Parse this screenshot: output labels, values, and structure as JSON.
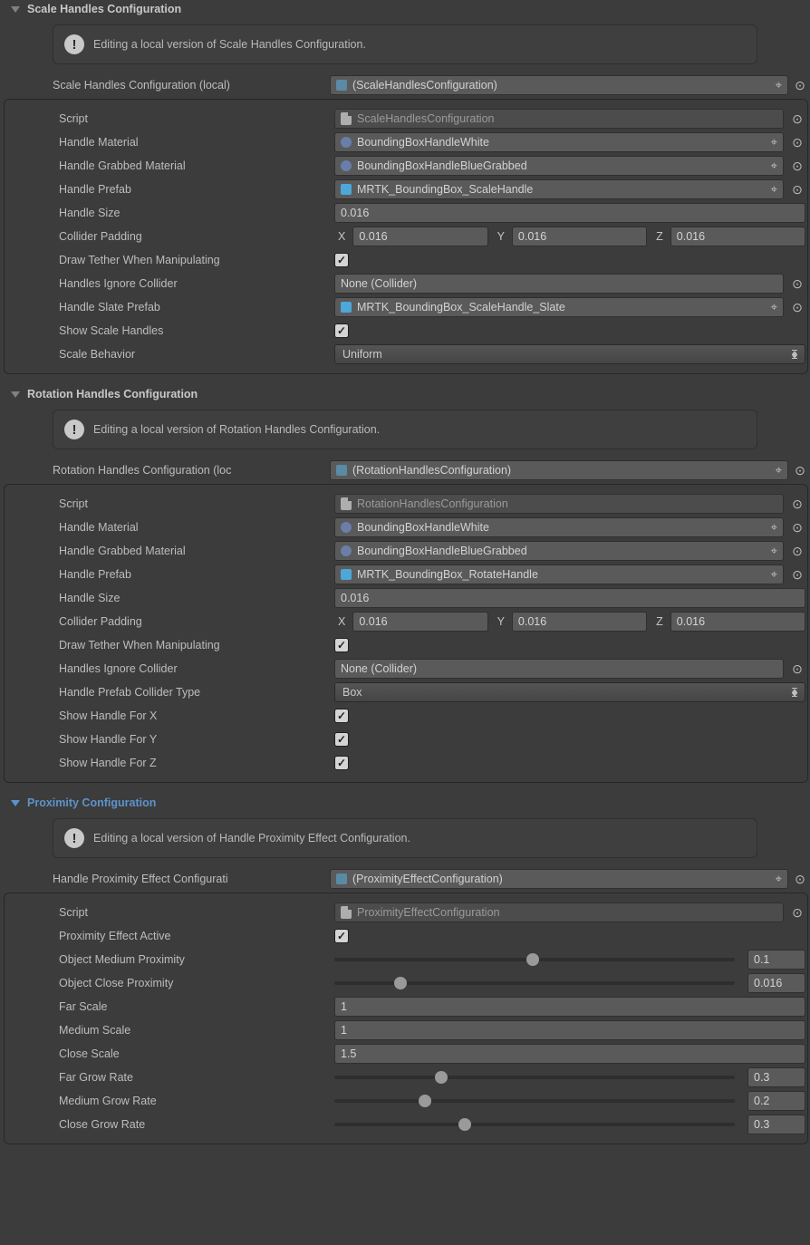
{
  "scale": {
    "title": "Scale Handles Configuration",
    "info": "Editing a local version of Scale Handles Configuration.",
    "cfg_label": "Scale Handles Configuration (local)",
    "cfg_value": "(ScaleHandlesConfiguration)",
    "script_label": "Script",
    "script_value": "ScaleHandlesConfiguration",
    "material_label": "Handle Material",
    "material_value": "BoundingBoxHandleWhite",
    "grabbed_label": "Handle Grabbed Material",
    "grabbed_value": "BoundingBoxHandleBlueGrabbed",
    "prefab_label": "Handle Prefab",
    "prefab_value": "MRTK_BoundingBox_ScaleHandle",
    "size_label": "Handle Size",
    "size_value": "0.016",
    "pad_label": "Collider Padding",
    "pad_x": "0.016",
    "pad_y": "0.016",
    "pad_z": "0.016",
    "tether_label": "Draw Tether When Manipulating",
    "ignore_label": "Handles Ignore Collider",
    "ignore_value": "None (Collider)",
    "slate_label": "Handle Slate Prefab",
    "slate_value": "MRTK_BoundingBox_ScaleHandle_Slate",
    "show_label": "Show Scale Handles",
    "behavior_label": "Scale Behavior",
    "behavior_value": "Uniform"
  },
  "rot": {
    "title": "Rotation Handles Configuration",
    "info": "Editing a local version of Rotation Handles Configuration.",
    "cfg_label": "Rotation Handles Configuration (loc",
    "cfg_value": "(RotationHandlesConfiguration)",
    "script_label": "Script",
    "script_value": "RotationHandlesConfiguration",
    "material_label": "Handle Material",
    "material_value": "BoundingBoxHandleWhite",
    "grabbed_label": "Handle Grabbed Material",
    "grabbed_value": "BoundingBoxHandleBlueGrabbed",
    "prefab_label": "Handle Prefab",
    "prefab_value": "MRTK_BoundingBox_RotateHandle",
    "size_label": "Handle Size",
    "size_value": "0.016",
    "pad_label": "Collider Padding",
    "pad_x": "0.016",
    "pad_y": "0.016",
    "pad_z": "0.016",
    "tether_label": "Draw Tether When Manipulating",
    "ignore_label": "Handles Ignore Collider",
    "ignore_value": "None (Collider)",
    "collider_type_label": "Handle Prefab Collider Type",
    "collider_type_value": "Box",
    "showx_label": "Show Handle For X",
    "showy_label": "Show Handle For Y",
    "showz_label": "Show Handle For Z"
  },
  "prox": {
    "title": "Proximity Configuration",
    "info": "Editing a local version of Handle Proximity Effect Configuration.",
    "cfg_label": "Handle Proximity Effect Configurati",
    "cfg_value": "(ProximityEffectConfiguration)",
    "script_label": "Script",
    "script_value": "ProximityEffectConfiguration",
    "active_label": "Proximity Effect Active",
    "medprox_label": "Object Medium Proximity",
    "medprox_value": "0.1",
    "medprox_pct": 48,
    "closeprox_label": "Object Close Proximity",
    "closeprox_value": "0.016",
    "closeprox_pct": 15,
    "farscale_label": "Far Scale",
    "farscale_value": "1",
    "medscale_label": "Medium Scale",
    "medscale_value": "1",
    "closescale_label": "Close Scale",
    "closescale_value": "1.5",
    "fargrow_label": "Far Grow Rate",
    "fargrow_value": "0.3",
    "fargrow_pct": 25,
    "medgrow_label": "Medium Grow Rate",
    "medgrow_value": "0.2",
    "medgrow_pct": 21,
    "closegrow_label": "Close Grow Rate",
    "closegrow_value": "0.3",
    "closegrow_pct": 31
  },
  "axis": {
    "x": "X",
    "y": "Y",
    "z": "Z"
  }
}
